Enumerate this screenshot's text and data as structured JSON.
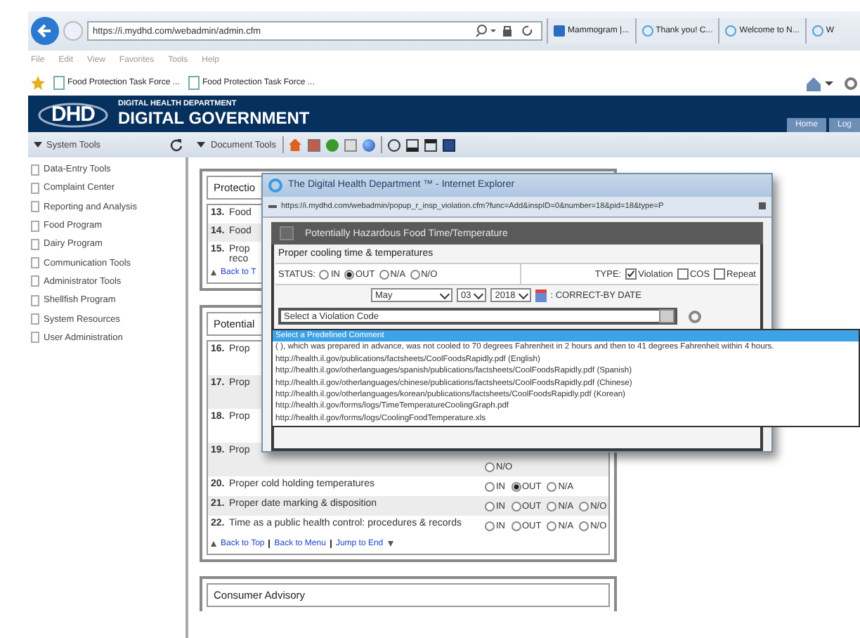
{
  "browser": {
    "address": "https://i.mydhd.com/webadmin/admin.cfm",
    "tabs": [
      {
        "label": "Mammogram |..."
      },
      {
        "label": "Thank you! C..."
      },
      {
        "label": "Welcome to N..."
      },
      {
        "label": "W"
      }
    ],
    "menu": [
      "File",
      "Edit",
      "View",
      "Favorites",
      "Tools",
      "Help"
    ],
    "favorites": [
      "Food Protection Task Force ...",
      "Food Protection Task Force ..."
    ]
  },
  "header": {
    "logo": "DHD",
    "subtitle": "DIGITAL HEALTH DEPARTMENT",
    "title": "DIGITAL GOVERNMENT",
    "nav": [
      "Home",
      "Log"
    ]
  },
  "toolbar": {
    "system_tools": "System Tools",
    "document_tools": "Document Tools"
  },
  "sidebar": {
    "items": [
      "Data-Entry Tools",
      "Complaint Center",
      "Reporting and Analysis",
      "Food Program",
      "Dairy Program",
      "Communication Tools",
      "Administrator Tools",
      "Shellfish Program",
      "System Resources",
      "User Administration"
    ]
  },
  "sections": [
    {
      "title": "Protectio",
      "rows": [
        {
          "number": "13.",
          "lines": [
            "Food"
          ],
          "options": []
        },
        {
          "number": "14.",
          "lines": [
            "Food"
          ],
          "options": []
        },
        {
          "number": "15.",
          "lines": [
            "Prop",
            "reco"
          ],
          "options": []
        }
      ],
      "links": [
        "Back to T"
      ]
    },
    {
      "title": "Potential",
      "rows": [
        {
          "number": "16.",
          "lines": [
            "Prop"
          ],
          "options": []
        },
        {
          "number": "17.",
          "lines": [
            "Prop"
          ],
          "options": []
        },
        {
          "number": "18.",
          "lines": [
            "Prop"
          ],
          "options": []
        },
        {
          "number": "19.",
          "lines": [
            "Prop"
          ],
          "options": [
            {
              "label": "N/O",
              "selected": false
            }
          ]
        },
        {
          "number": "20.",
          "lines": [
            "Proper cold holding temperatures"
          ],
          "options": [
            {
              "label": "IN",
              "selected": false
            },
            {
              "label": "OUT",
              "selected": true
            },
            {
              "label": "N/A",
              "selected": false
            }
          ]
        },
        {
          "number": "21.",
          "lines": [
            "Proper date marking & disposition"
          ],
          "options": [
            {
              "label": "IN",
              "selected": false
            },
            {
              "label": "OUT",
              "selected": false
            },
            {
              "label": "N/A",
              "selected": false
            },
            {
              "label": "N/O",
              "selected": false
            }
          ]
        },
        {
          "number": "22.",
          "lines": [
            "Time as a public health control: procedures & records"
          ],
          "options": [
            {
              "label": "IN",
              "selected": false
            },
            {
              "label": "OUT",
              "selected": false
            },
            {
              "label": "N/A",
              "selected": false
            },
            {
              "label": "N/O",
              "selected": false
            }
          ]
        }
      ],
      "links": [
        "Back to Top",
        "Back to Menu",
        "Jump to End"
      ]
    },
    {
      "title": "Consumer Advisory"
    }
  ],
  "popup": {
    "title": "The Digital Health Department ™ - Internet Explorer",
    "address": "https://i.mydhd.com/webadmin/popup_r_insp_violation.cfm?func=Add&inspID=0&number=18&pid=18&type=P",
    "heading": "Potentially Hazardous Food Time/Temperature",
    "item": "Proper cooling time & temperatures",
    "status_label": "STATUS:",
    "status": [
      {
        "label": "IN",
        "selected": false
      },
      {
        "label": "OUT",
        "selected": true
      },
      {
        "label": "N/A",
        "selected": false
      },
      {
        "label": "N/O",
        "selected": false
      }
    ],
    "type_label": "TYPE:",
    "types": [
      {
        "label": "Violation",
        "checked": true
      },
      {
        "label": "COS",
        "checked": false
      },
      {
        "label": "Repeat",
        "checked": false
      }
    ],
    "month": "May",
    "day": "03",
    "year": "2018",
    "date_label": ": CORRECT-BY DATE",
    "violation_select": "Select a Violation Code",
    "comments": [
      {
        "text": "Select a Predefined Comment",
        "selected": true
      },
      {
        "text": "( ), which was prepared in advance, was not cooled to 70 degrees Fahrenheit in 2 hours and then to 41 degrees Fahrenheit within 4 hours.",
        "selected": false
      },
      {
        "text": "http://health.il.gov/publications/factsheets/CoolFoodsRapidly.pdf (English)",
        "selected": false
      },
      {
        "text": "http://health.il.gov/otherlanguages/spanish/publications/factsheets/CoolFoodsRapidly.pdf (Spanish)",
        "selected": false
      },
      {
        "text": "http://health.il.gov/otherlanguages/chinese/publications/factsheets/CoolFoodsRapidly.pdf (Chinese)",
        "selected": false
      },
      {
        "text": "http://health.il.gov/otherlanguages/korean/publications/factsheets/CoolFoodsRapidly.pdf (Korean)",
        "selected": false
      },
      {
        "text": "http://health.il.gov/forms/logs/TimeTemperatureCoolingGraph.pdf",
        "selected": false
      },
      {
        "text": "http://health.il.gov/forms/logs/CoolingFoodTemperature.xls",
        "selected": false
      }
    ]
  }
}
